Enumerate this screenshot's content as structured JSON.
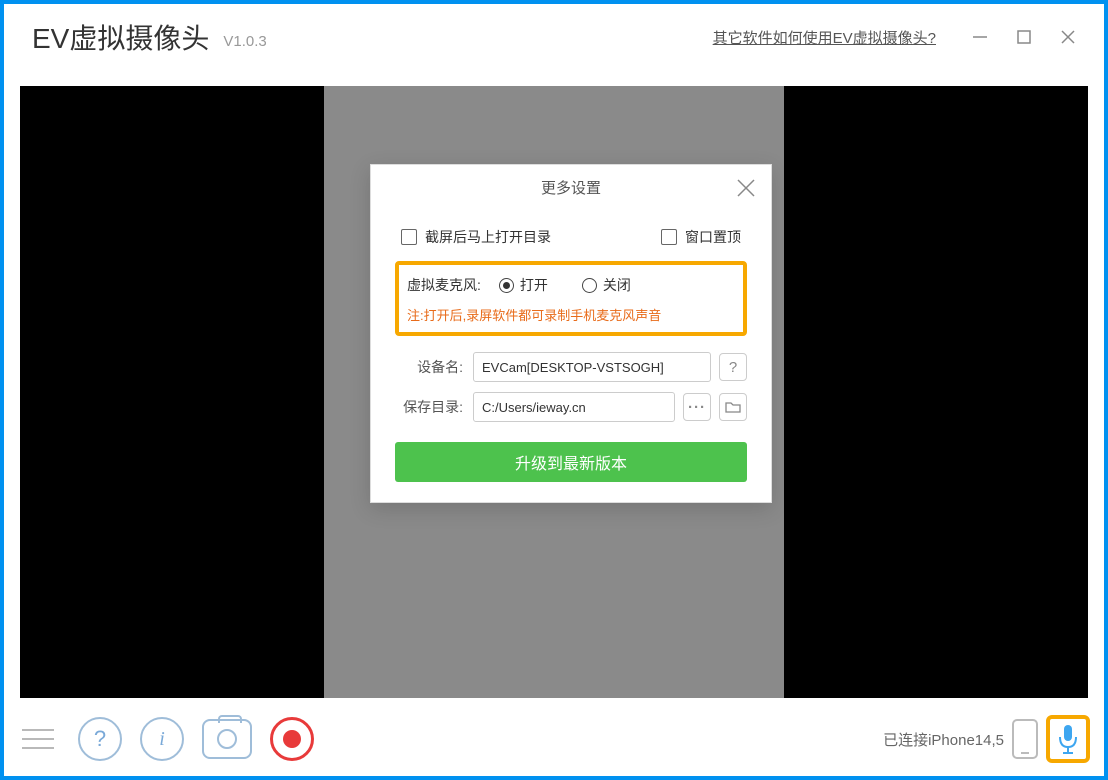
{
  "titlebar": {
    "app_title": "EV虚拟摄像头",
    "version": "V1.0.3",
    "help_link": "其它软件如何使用EV虚拟摄像头?"
  },
  "dialog": {
    "title": "更多设置",
    "checkbox_open_dir": "截屏后马上打开目录",
    "checkbox_topmost": "窗口置顶",
    "mic_label": "虚拟麦克风:",
    "radio_on": "打开",
    "radio_off": "关闭",
    "mic_note": "注:打开后,录屏软件都可录制手机麦克风声音",
    "device_label": "设备名:",
    "device_value": "EVCam[DESKTOP-VSTSOGH]",
    "save_label": "保存目录:",
    "save_value": "C:/Users/ieway.cn",
    "upgrade_label": "升级到最新版本"
  },
  "bottombar": {
    "status": "已连接iPhone14,5"
  }
}
